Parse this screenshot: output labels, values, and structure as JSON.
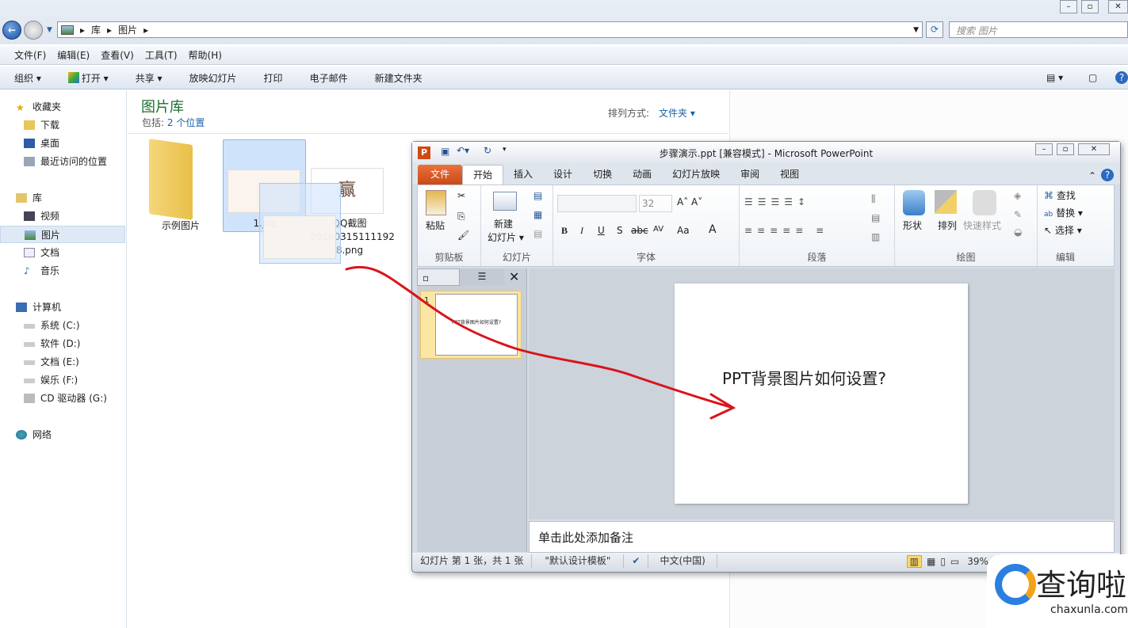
{
  "explorer": {
    "breadcrumb": [
      "库",
      "图片"
    ],
    "search_placeholder": "搜索 图片",
    "menu": [
      "文件(F)",
      "编辑(E)",
      "查看(V)",
      "工具(T)",
      "帮助(H)"
    ],
    "commands": [
      "组织 ▾",
      "打开 ▾",
      "共享 ▾",
      "放映幻灯片",
      "打印",
      "电子邮件",
      "新建文件夹"
    ],
    "sidebar": {
      "favorites": {
        "label": "收藏夹",
        "items": [
          "下载",
          "桌面",
          "最近访问的位置"
        ]
      },
      "libraries": {
        "label": "库",
        "items": [
          "视频",
          "图片",
          "文档",
          "音乐"
        ],
        "selected": "图片"
      },
      "computer": {
        "label": "计算机",
        "items": [
          "系统 (C:)",
          "软件 (D:)",
          "文档 (E:)",
          "娱乐 (F:)",
          "CD 驱动器 (G:)"
        ]
      },
      "network": {
        "label": "网络"
      }
    },
    "library_title": "图片库",
    "includes_label": "包括:",
    "includes_link": "2 个位置",
    "arrange_label": "排列方式:",
    "arrange_value": "文件夹 ▾",
    "files": [
      {
        "name": "示例图片",
        "type": "folder"
      },
      {
        "name": "1.jpg",
        "type": "image",
        "selected": true
      },
      {
        "name": "QQ截图20160315111928.png",
        "line1": "QQ截图",
        "line2": "20160315111192",
        "line3": "8.png",
        "type": "image",
        "thumb_char": "赢"
      }
    ]
  },
  "ppt": {
    "title": "步骤演示.ppt [兼容模式] - Microsoft PowerPoint",
    "tabs": [
      "文件",
      "开始",
      "插入",
      "设计",
      "切换",
      "动画",
      "幻灯片放映",
      "审阅",
      "视图"
    ],
    "active_tab": "开始",
    "groups": {
      "clipboard": {
        "label": "剪贴板",
        "paste": "粘贴"
      },
      "slides": {
        "label": "幻灯片",
        "new_slide_1": "新建",
        "new_slide_2": "幻灯片 ▾"
      },
      "font": {
        "label": "字体",
        "size": "32",
        "buttons": [
          "B",
          "I",
          "U",
          "S",
          "abc",
          "AV",
          "Aa",
          "A"
        ]
      },
      "paragraph": {
        "label": "段落"
      },
      "drawing": {
        "label": "绘图",
        "shapes": "形状",
        "arrange": "排列",
        "quick_styles": "快速样式"
      },
      "editing": {
        "label": "编辑",
        "find": "查找",
        "replace": "替换 ▾",
        "select": "选择 ▾"
      }
    },
    "thumbnail_number": "1",
    "thumbnail_text": "PPT背景图片如何设置?",
    "slide_text": "PPT背景图片如何设置?",
    "notes_placeholder": "单击此处添加备注",
    "status": {
      "slide": "幻灯片 第 1 张，共 1 张",
      "theme": "\"默认设计模板\"",
      "language": "中文(中国)",
      "zoom": "39%"
    }
  },
  "watermark": {
    "brand": "查询啦",
    "url": "chaxunla.com"
  },
  "colors": {
    "annotation_arrow": "#d9141b",
    "file_tab": "#d85a24",
    "library_title": "#1e6e2e",
    "link": "#1b5fa8"
  }
}
